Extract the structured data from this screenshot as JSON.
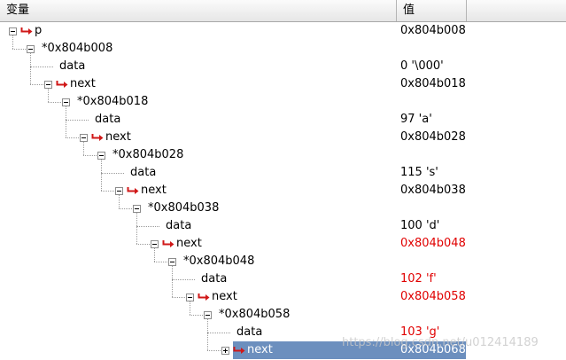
{
  "header": {
    "col_variable": "变量",
    "col_value": "值"
  },
  "tree": [
    {
      "label": "p",
      "value": "0x804b008",
      "depth": 0,
      "kind": "pointer",
      "expanded": true,
      "changed": false,
      "selected": false
    },
    {
      "label": "*0x804b008",
      "value": "",
      "depth": 1,
      "kind": "struct",
      "expanded": true,
      "changed": false,
      "selected": false
    },
    {
      "label": "data",
      "value": "0 '\\000'",
      "depth": 2,
      "kind": "leaf",
      "expanded": false,
      "changed": false,
      "selected": false
    },
    {
      "label": "next",
      "value": "0x804b018",
      "depth": 2,
      "kind": "pointer",
      "expanded": true,
      "changed": false,
      "selected": false
    },
    {
      "label": "*0x804b018",
      "value": "",
      "depth": 3,
      "kind": "struct",
      "expanded": true,
      "changed": false,
      "selected": false
    },
    {
      "label": "data",
      "value": "97 'a'",
      "depth": 4,
      "kind": "leaf",
      "expanded": false,
      "changed": false,
      "selected": false
    },
    {
      "label": "next",
      "value": "0x804b028",
      "depth": 4,
      "kind": "pointer",
      "expanded": true,
      "changed": false,
      "selected": false
    },
    {
      "label": "*0x804b028",
      "value": "",
      "depth": 5,
      "kind": "struct",
      "expanded": true,
      "changed": false,
      "selected": false
    },
    {
      "label": "data",
      "value": "115 's'",
      "depth": 6,
      "kind": "leaf",
      "expanded": false,
      "changed": false,
      "selected": false
    },
    {
      "label": "next",
      "value": "0x804b038",
      "depth": 6,
      "kind": "pointer",
      "expanded": true,
      "changed": false,
      "selected": false
    },
    {
      "label": "*0x804b038",
      "value": "",
      "depth": 7,
      "kind": "struct",
      "expanded": true,
      "changed": false,
      "selected": false
    },
    {
      "label": "data",
      "value": "100 'd'",
      "depth": 8,
      "kind": "leaf",
      "expanded": false,
      "changed": false,
      "selected": false
    },
    {
      "label": "next",
      "value": "0x804b048",
      "depth": 8,
      "kind": "pointer",
      "expanded": true,
      "changed": true,
      "selected": false
    },
    {
      "label": "*0x804b048",
      "value": "",
      "depth": 9,
      "kind": "struct",
      "expanded": true,
      "changed": false,
      "selected": false
    },
    {
      "label": "data",
      "value": "102 'f'",
      "depth": 10,
      "kind": "leaf",
      "expanded": false,
      "changed": true,
      "selected": false
    },
    {
      "label": "next",
      "value": "0x804b058",
      "depth": 10,
      "kind": "pointer",
      "expanded": true,
      "changed": true,
      "selected": false
    },
    {
      "label": "*0x804b058",
      "value": "",
      "depth": 11,
      "kind": "struct",
      "expanded": true,
      "changed": false,
      "selected": false
    },
    {
      "label": "data",
      "value": "103 'g'",
      "depth": 12,
      "kind": "leaf",
      "expanded": false,
      "changed": true,
      "selected": false
    },
    {
      "label": "next",
      "value": "0x804b068",
      "depth": 12,
      "kind": "pointer",
      "expanded": false,
      "changed": false,
      "selected": true
    }
  ],
  "colors": {
    "changed": "#e00000",
    "selection": "#6c8fbe",
    "pointer_icon": "#d01818"
  },
  "icons": {
    "pointer": "pointer-arrow-icon",
    "collapse": "collapse-minus-icon",
    "expand": "expand-plus-icon"
  },
  "watermark": "https://blog.csdn.net/u012414189"
}
